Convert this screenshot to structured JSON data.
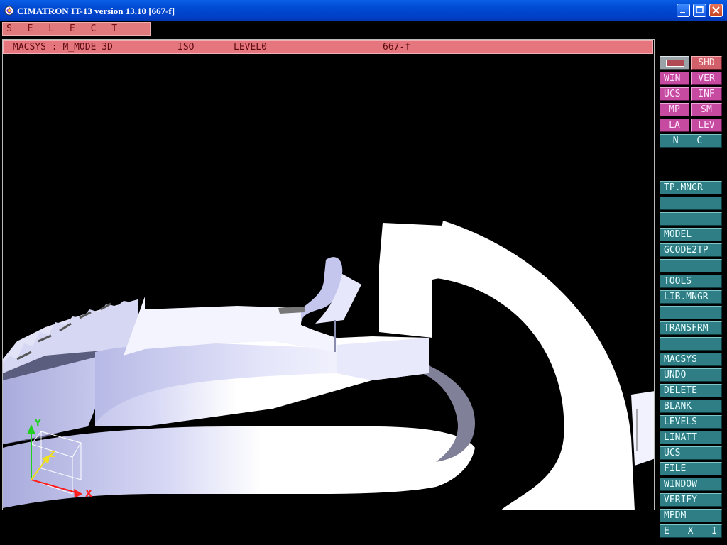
{
  "window": {
    "title": "CIMATRON IT-13 version 13.10 [667-f]",
    "controls": [
      "minimize",
      "maximize",
      "close"
    ]
  },
  "select_bar": {
    "label": "S E L E C T"
  },
  "status_bar": {
    "mode": "MACSYS : M_MODE 3D",
    "view": "ISO",
    "level": "LEVEL0",
    "file": "667-f"
  },
  "top_menu": {
    "color_swatch": "#b04b55",
    "shd": "SHD",
    "win": "WIN",
    "ver": "VER",
    "ucs": "UCS",
    "inf": "INF",
    "mp": "MP",
    "sm": "SM",
    "la": "LA",
    "lev": "LEV",
    "nc": "N C"
  },
  "main_menu": {
    "items": [
      "TP.MNGR",
      "",
      "",
      "MODEL",
      "GCODE2TP",
      "",
      "TOOLS",
      "LIB.MNGR",
      "",
      "TRANSFRM",
      "",
      "MACSYS",
      "UNDO",
      "DELETE",
      "BLANK",
      "LEVELS",
      "LINATT",
      "UCS",
      "FILE",
      "WINDOW",
      "VERIFY",
      "MPDM",
      "E X I T"
    ]
  },
  "axes": {
    "x": "X",
    "y": "Y",
    "z": "Z"
  },
  "colors": {
    "titlebar": "#0149d1",
    "menu_teal": "#2f7e86",
    "menu_magenta": "#c64aa0",
    "menu_pink": "#d2606a",
    "status_pink": "#e6767d",
    "model_lavender": "#c4c6ee",
    "axis_x": "#ff2020",
    "axis_y": "#20d020",
    "axis_z": "#f0e020"
  }
}
